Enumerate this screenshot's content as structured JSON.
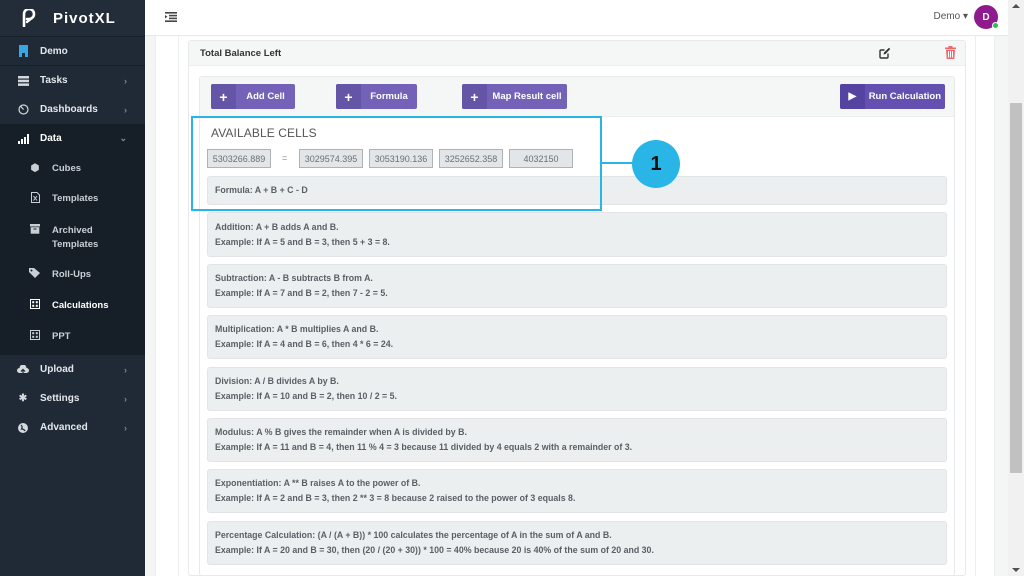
{
  "app": {
    "name": "PivotXL"
  },
  "sidebar": {
    "items": [
      {
        "label": "Demo",
        "icon": "bookmark-icon"
      },
      {
        "label": "Tasks",
        "icon": "tasks-icon",
        "chevron": "›"
      },
      {
        "label": "Dashboards",
        "icon": "dashboard-icon",
        "chevron": "›"
      },
      {
        "label": "Data",
        "icon": "bar-chart-icon",
        "chevron": "⌄"
      },
      {
        "label": "Upload",
        "icon": "cloud-upload-icon",
        "chevron": "›"
      },
      {
        "label": "Settings",
        "icon": "gear-icon",
        "chevron": "›"
      },
      {
        "label": "Advanced",
        "icon": "globe-icon",
        "chevron": "›"
      }
    ],
    "data_subitems": [
      {
        "label": "Cubes",
        "icon": "cube-icon"
      },
      {
        "label": "Templates",
        "icon": "file-excel-icon"
      },
      {
        "label": "Archived Templates",
        "icon": "archive-icon"
      },
      {
        "label": "Roll-Ups",
        "icon": "tags-icon"
      },
      {
        "label": "Calculations",
        "icon": "calculator-icon",
        "active": true
      },
      {
        "label": "PPT",
        "icon": "table-icon"
      }
    ]
  },
  "topbar": {
    "user_label": "Demo ▾",
    "avatar_initial": "D",
    "avatar_color": "#8e1a8e",
    "status_color": "#27c24c"
  },
  "card": {
    "title": "Total Balance Left"
  },
  "toolbar": {
    "add_cell_label": "Add Cell",
    "formula_label": "Formula",
    "map_result_label": "Map Result cell",
    "run_label": "Run Calculation",
    "button_color": "#7462b8"
  },
  "available_cells": {
    "title": "AVAILABLE CELLS",
    "result_value": "5303266.889",
    "equals": "=",
    "cells": [
      "3029574.395",
      "3053190.136",
      "3252652.358",
      "4032150"
    ]
  },
  "formula": {
    "text": "Formula: A + B + C - D"
  },
  "help": [
    {
      "line1": "Addition: A + B adds A and B.",
      "line2": "Example: If A = 5 and B = 3, then 5 + 3 = 8."
    },
    {
      "line1": "Subtraction: A - B subtracts B from A.",
      "line2": "Example: If A = 7 and B = 2, then 7 - 2 = 5."
    },
    {
      "line1": "Multiplication: A * B multiplies A and B.",
      "line2": "Example: If A = 4 and B = 6, then 4 * 6 = 24."
    },
    {
      "line1": "Division: A / B divides A by B.",
      "line2": "Example: If A = 10 and B = 2, then 10 / 2 = 5."
    },
    {
      "line1": "Modulus: A % B gives the remainder when A is divided by B.",
      "line2": "Example: If A = 11 and B = 4, then 11 % 4 = 3 because 11 divided by 4 equals 2 with a remainder of 3."
    },
    {
      "line1": "Exponentiation: A ** B raises A to the power of B.",
      "line2": "Example: If A = 2 and B = 3, then 2 ** 3 = 8 because 2 raised to the power of 3 equals 8."
    },
    {
      "line1": "Percentage Calculation: (A / (A + B)) * 100 calculates the percentage of A in the sum of A and B.",
      "line2": "Example: If A = 20 and B = 30, then (20 / (20 + 30)) * 100 = 40% because 20 is 40% of the sum of 20 and 30."
    }
  ],
  "annotation": {
    "badge_number": "1",
    "color": "#29b6e6"
  }
}
